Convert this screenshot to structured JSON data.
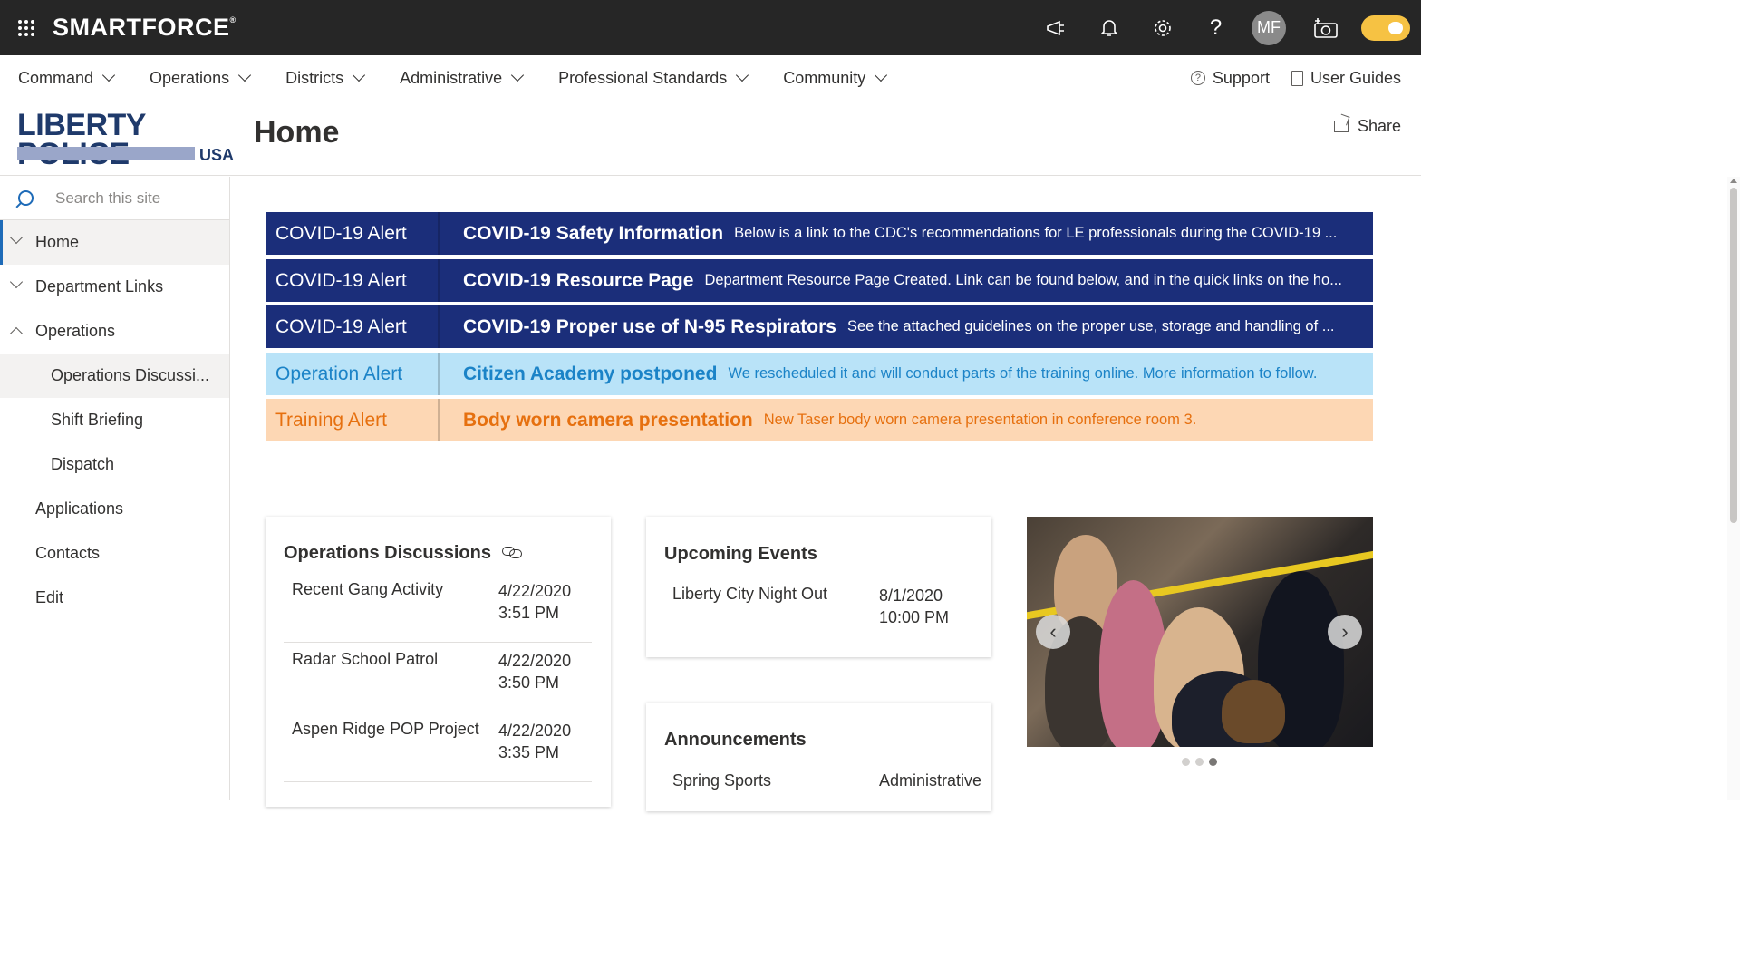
{
  "suitebar": {
    "brand": "SMARTFORCE",
    "brand_mark": "®",
    "avatar_initials": "MF",
    "icons": [
      "megaphone-icon",
      "bell-icon",
      "gear-icon",
      "help-icon",
      "camera-icon"
    ]
  },
  "topnav": {
    "items": [
      "Command",
      "Operations",
      "Districts",
      "Administrative",
      "Professional Standards",
      "Community"
    ],
    "support": "Support",
    "user_guides": "User Guides"
  },
  "header": {
    "logo_top": "LIBERTY POLICE",
    "logo_bottom": "USA",
    "page_title": "Home",
    "share": "Share"
  },
  "leftnav": {
    "search_placeholder": "Search this site",
    "items": [
      {
        "label": "Home"
      },
      {
        "label": "Department Links"
      },
      {
        "label": "Operations"
      },
      {
        "label": "Operations Discussi..."
      },
      {
        "label": "Shift Briefing"
      },
      {
        "label": "Dispatch"
      },
      {
        "label": "Applications"
      },
      {
        "label": "Contacts"
      },
      {
        "label": "Edit"
      }
    ]
  },
  "alerts": [
    {
      "type": "COVID-19 Alert",
      "title": "COVID-19 Safety Information",
      "desc": "Below is a link to the CDC's recommendations for LE professionals during the COVID-19 ..."
    },
    {
      "type": "COVID-19 Alert",
      "title": "COVID-19 Resource Page",
      "desc": "Department Resource Page Created. Link can be found below, and in the quick links on the ho..."
    },
    {
      "type": "COVID-19 Alert",
      "title": "COVID-19 Proper use of N-95 Respirators",
      "desc": "See the attached guidelines on the proper use, storage and handling of ..."
    },
    {
      "type": "Operation Alert",
      "title": "Citizen Academy postponed",
      "desc": "We rescheduled it and will conduct parts of the training online. More information to follow."
    },
    {
      "type": "Training Alert",
      "title": "Body worn camera presentation",
      "desc": "New Taser body worn camera presentation in conference room 3."
    }
  ],
  "colors": {
    "covid_alert": "#1b2e7a",
    "operation_alert_bg": "#b9e3f8",
    "operation_alert_text": "#1b83c7",
    "training_alert_bg": "#fdd7b4",
    "training_alert_text": "#e6700f",
    "accent": "#1e6bb8"
  },
  "discussions": {
    "title": "Operations Discussions",
    "rows": [
      {
        "title": "Recent Gang Activity",
        "date": "4/22/2020",
        "time": "3:51 PM"
      },
      {
        "title": "Radar School Patrol",
        "date": "4/22/2020",
        "time": "3:50 PM"
      },
      {
        "title": "Aspen Ridge POP Project",
        "date": "4/22/2020",
        "time": "3:35 PM"
      }
    ]
  },
  "events": {
    "title": "Upcoming Events",
    "rows": [
      {
        "title": "Liberty City Night Out",
        "date": "8/1/2020",
        "time": "10:00 PM"
      }
    ]
  },
  "announcements": {
    "title": "Announcements",
    "rows": [
      {
        "title": "Spring Sports",
        "category": "Administrative"
      }
    ]
  },
  "carousel": {
    "prev": "‹",
    "next": "›",
    "slide_count": 3,
    "active_slide": 3
  }
}
